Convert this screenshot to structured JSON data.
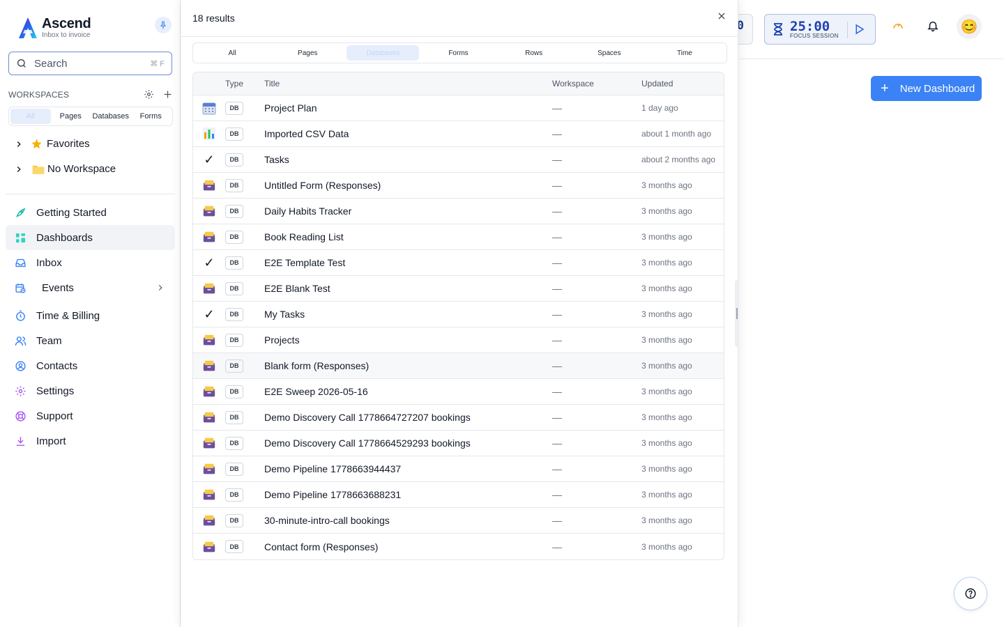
{
  "brand": {
    "name": "Ascend",
    "tagline": "Inbox to invoice"
  },
  "search": {
    "label": "Search",
    "shortcut": "⌘ F"
  },
  "workspaces": {
    "heading": "WORKSPACES",
    "tabs": [
      "All",
      "Pages",
      "Databases",
      "Forms"
    ],
    "items": [
      {
        "label": "Favorites",
        "icon": "star-icon"
      },
      {
        "label": "No Workspace",
        "icon": "folder-icon"
      }
    ]
  },
  "nav": [
    {
      "label": "Getting Started",
      "icon": "rocket-icon"
    },
    {
      "label": "Dashboards",
      "icon": "dashboard-grid-icon"
    },
    {
      "label": "Inbox",
      "icon": "inbox-icon"
    },
    {
      "label": "Events",
      "icon": "calendar-clock-icon"
    },
    {
      "label": "Time & Billing",
      "icon": "stopwatch-icon"
    },
    {
      "label": "Team",
      "icon": "team-icon"
    },
    {
      "label": "Contacts",
      "icon": "contact-icon"
    },
    {
      "label": "Settings",
      "icon": "gear-icon"
    },
    {
      "label": "Support",
      "icon": "lifebuoy-icon"
    },
    {
      "label": "Import",
      "icon": "download-icon"
    }
  ],
  "topbar": {
    "stat_digit": "0",
    "timer": {
      "time": "25:00",
      "label": "FOCUS SESSION"
    },
    "avatar": "😊"
  },
  "main": {
    "new_dashboard_label": "New Dashboard"
  },
  "results": {
    "count_label": "18 results",
    "filter_tabs": [
      "All",
      "Pages",
      "Databases",
      "Forms",
      "Rows",
      "Spaces",
      "Time"
    ],
    "active_filter": "Databases",
    "columns": {
      "type": "Type",
      "title": "Title",
      "workspace": "Workspace",
      "updated": "Updated"
    },
    "rows": [
      {
        "icon": "calendar-icon",
        "type": "DB",
        "title": "Project Plan",
        "workspace": "—",
        "updated": "1 day ago"
      },
      {
        "icon": "bar-chart-icon",
        "type": "DB",
        "title": "Imported CSV Data",
        "workspace": "—",
        "updated": "about 1 month ago"
      },
      {
        "icon": "checkmark-icon",
        "type": "DB",
        "title": "Tasks",
        "workspace": "—",
        "updated": "about 2 months ago"
      },
      {
        "icon": "file-box-icon",
        "type": "DB",
        "title": "Untitled Form (Responses)",
        "workspace": "—",
        "updated": "3 months ago"
      },
      {
        "icon": "file-box-icon",
        "type": "DB",
        "title": "Daily Habits Tracker",
        "workspace": "—",
        "updated": "3 months ago"
      },
      {
        "icon": "file-box-icon",
        "type": "DB",
        "title": "Book Reading List",
        "workspace": "—",
        "updated": "3 months ago"
      },
      {
        "icon": "checkmark-icon",
        "type": "DB",
        "title": "E2E Template Test",
        "workspace": "—",
        "updated": "3 months ago"
      },
      {
        "icon": "file-box-icon",
        "type": "DB",
        "title": "E2E Blank Test",
        "workspace": "—",
        "updated": "3 months ago"
      },
      {
        "icon": "checkmark-icon",
        "type": "DB",
        "title": "My Tasks",
        "workspace": "—",
        "updated": "3 months ago"
      },
      {
        "icon": "file-box-icon",
        "type": "DB",
        "title": "Projects",
        "workspace": "—",
        "updated": "3 months ago"
      },
      {
        "icon": "file-box-icon",
        "type": "DB",
        "title": "Blank form (Responses)",
        "workspace": "—",
        "updated": "3 months ago"
      },
      {
        "icon": "file-box-icon",
        "type": "DB",
        "title": "E2E Sweep 2026-05-16",
        "workspace": "—",
        "updated": "3 months ago"
      },
      {
        "icon": "file-box-icon",
        "type": "DB",
        "title": "Demo Discovery Call 1778664727207 bookings",
        "workspace": "—",
        "updated": "3 months ago"
      },
      {
        "icon": "file-box-icon",
        "type": "DB",
        "title": "Demo Discovery Call 1778664529293 bookings",
        "workspace": "—",
        "updated": "3 months ago"
      },
      {
        "icon": "file-box-icon",
        "type": "DB",
        "title": "Demo Pipeline 1778663944437",
        "workspace": "—",
        "updated": "3 months ago"
      },
      {
        "icon": "file-box-icon",
        "type": "DB",
        "title": "Demo Pipeline 1778663688231",
        "workspace": "—",
        "updated": "3 months ago"
      },
      {
        "icon": "file-box-icon",
        "type": "DB",
        "title": "30-minute-intro-call bookings",
        "workspace": "—",
        "updated": "3 months ago"
      },
      {
        "icon": "file-box-icon",
        "type": "DB",
        "title": "Contact form (Responses)",
        "workspace": "—",
        "updated": "3 months ago"
      }
    ]
  },
  "colors": {
    "accent": "#3b82f6",
    "active_tab_bg": "#e6eefc",
    "timer_text": "#1e40af"
  }
}
